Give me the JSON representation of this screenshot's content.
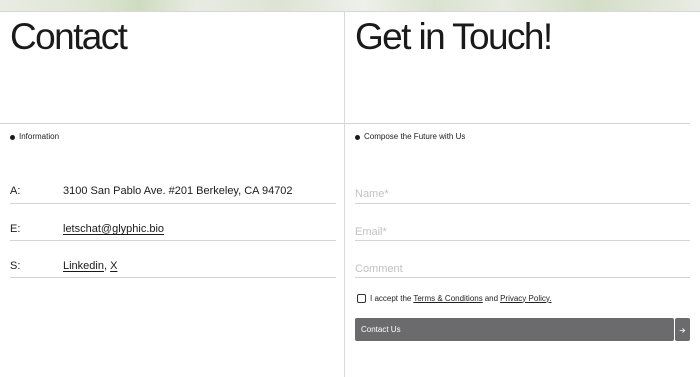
{
  "left": {
    "title": "Contact",
    "section_label": "Information",
    "rows": [
      {
        "key": "A:",
        "value": "3100 San Pablo Ave. #201 Berkeley, CA 94702"
      },
      {
        "key": "E:",
        "value": "letschat@glyphic.bio"
      },
      {
        "key": "S:",
        "links": [
          "Linkedin",
          "X"
        ],
        "separator": ","
      }
    ]
  },
  "right": {
    "title": "Get in Touch!",
    "section_label": "Compose the Future with Us",
    "fields": {
      "name_placeholder": "Name*",
      "email_placeholder": "Email*",
      "comment_placeholder": "Comment"
    },
    "consent": {
      "prefix": "I accept the",
      "terms_link": "Terms & Conditions",
      "and": "and",
      "privacy_link": "Privacy Policy."
    },
    "submit_label": "Contact Us",
    "submit_icon": "arrow-right-icon"
  }
}
